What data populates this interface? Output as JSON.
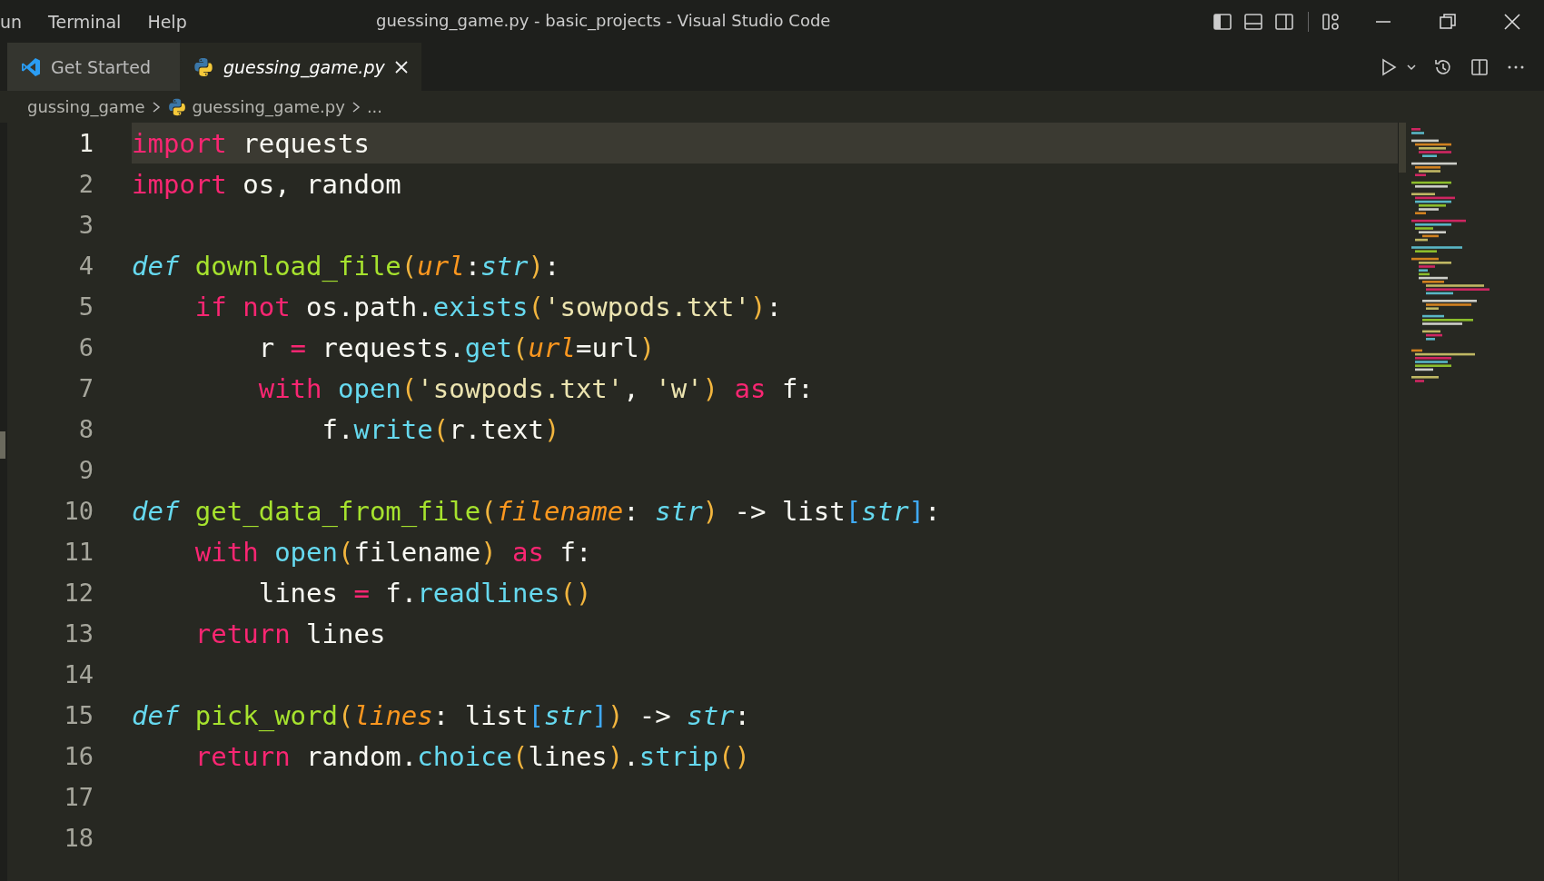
{
  "menu": [
    "un",
    "Terminal",
    "Help"
  ],
  "window": {
    "title": "guessing_game.py - basic_projects - Visual Studio Code"
  },
  "tabs": [
    {
      "label": "Get Started",
      "kind": "welcome",
      "selected": false,
      "preview": false,
      "close": false
    },
    {
      "label": "guessing_game.py",
      "kind": "python-file",
      "selected": true,
      "preview": true,
      "close": true
    }
  ],
  "breadcrumbs": [
    {
      "label": "gussing_game",
      "kind": "folder"
    },
    {
      "label": "guessing_game.py",
      "kind": "python-file"
    },
    {
      "label": "...",
      "kind": "symbol"
    }
  ],
  "editor": {
    "lines": [
      {
        "number": "1",
        "current": true,
        "tokens": [
          {
            "text": "import",
            "kind": "keyword"
          },
          {
            "text": " requests",
            "kind": "plain"
          }
        ]
      },
      {
        "number": "2",
        "current": false,
        "tokens": [
          {
            "text": "import",
            "kind": "keyword"
          },
          {
            "text": " os, random",
            "kind": "plain"
          }
        ]
      },
      {
        "number": "3",
        "current": false
      },
      {
        "number": "4",
        "current": false,
        "tokens": [
          {
            "text": "def",
            "kind": "storage"
          },
          {
            "text": " download_file",
            "kind": "function"
          },
          {
            "text": "(",
            "kind": "bracket"
          },
          {
            "text": "url",
            "kind": "param"
          },
          {
            "text": ":",
            "kind": "plain"
          },
          {
            "text": "str",
            "kind": "type"
          },
          {
            "text": ")",
            "kind": "bracket"
          },
          {
            "text": ":",
            "kind": "plain"
          }
        ]
      },
      {
        "number": "5",
        "current": false,
        "tokens": [
          {
            "text": "    if",
            "kind": "keyword"
          },
          {
            "text": " not",
            "kind": "keyword"
          },
          {
            "text": " os.path.",
            "kind": "plain"
          },
          {
            "text": "exists",
            "kind": "call"
          },
          {
            "text": "(",
            "kind": "bracket"
          },
          {
            "text": "'sowpods.txt'",
            "kind": "string"
          },
          {
            "text": ")",
            "kind": "bracket"
          },
          {
            "text": ":",
            "kind": "plain"
          }
        ]
      },
      {
        "number": "6",
        "current": false,
        "tokens": [
          {
            "text": "        r ",
            "kind": "plain"
          },
          {
            "text": "=",
            "kind": "operator"
          },
          {
            "text": " requests.",
            "kind": "plain"
          },
          {
            "text": "get",
            "kind": "call"
          },
          {
            "text": "(",
            "kind": "bracket"
          },
          {
            "text": "url",
            "kind": "param"
          },
          {
            "text": "=url",
            "kind": "plain"
          },
          {
            "text": ")",
            "kind": "bracket"
          }
        ]
      },
      {
        "number": "7",
        "current": false,
        "tokens": [
          {
            "text": "        with",
            "kind": "keyword"
          },
          {
            "text": " open",
            "kind": "call"
          },
          {
            "text": "(",
            "kind": "bracket"
          },
          {
            "text": "'sowpods.txt'",
            "kind": "string"
          },
          {
            "text": ",",
            "kind": "plain"
          },
          {
            "text": " 'w'",
            "kind": "string"
          },
          {
            "text": ")",
            "kind": "bracket"
          },
          {
            "text": " as",
            "kind": "keyword"
          },
          {
            "text": " f:",
            "kind": "plain"
          }
        ]
      },
      {
        "number": "8",
        "current": false,
        "tokens": [
          {
            "text": "            f.",
            "kind": "plain"
          },
          {
            "text": "write",
            "kind": "call"
          },
          {
            "text": "(",
            "kind": "bracket"
          },
          {
            "text": "r.text",
            "kind": "plain"
          },
          {
            "text": ")",
            "kind": "bracket"
          }
        ]
      },
      {
        "number": "9",
        "current": false
      },
      {
        "number": "10",
        "current": false,
        "tokens": [
          {
            "text": "def",
            "kind": "storage"
          },
          {
            "text": " get_data_from_file",
            "kind": "function"
          },
          {
            "text": "(",
            "kind": "bracket"
          },
          {
            "text": "filename",
            "kind": "param"
          },
          {
            "text": ":",
            "kind": "plain"
          },
          {
            "text": " str",
            "kind": "type"
          },
          {
            "text": ")",
            "kind": "bracket"
          },
          {
            "text": " -> list",
            "kind": "plain"
          },
          {
            "text": "[",
            "kind": "bracket2"
          },
          {
            "text": "str",
            "kind": "type"
          },
          {
            "text": "]",
            "kind": "bracket2"
          },
          {
            "text": ":",
            "kind": "plain"
          }
        ]
      },
      {
        "number": "11",
        "current": false,
        "tokens": [
          {
            "text": "    with",
            "kind": "keyword"
          },
          {
            "text": " open",
            "kind": "call"
          },
          {
            "text": "(",
            "kind": "bracket"
          },
          {
            "text": "filename",
            "kind": "plain"
          },
          {
            "text": ")",
            "kind": "bracket"
          },
          {
            "text": " as",
            "kind": "keyword"
          },
          {
            "text": " f:",
            "kind": "plain"
          }
        ]
      },
      {
        "number": "12",
        "current": false,
        "tokens": [
          {
            "text": "        lines ",
            "kind": "plain"
          },
          {
            "text": "=",
            "kind": "operator"
          },
          {
            "text": " f.",
            "kind": "plain"
          },
          {
            "text": "readlines",
            "kind": "call"
          },
          {
            "text": "()",
            "kind": "bracket"
          }
        ]
      },
      {
        "number": "13",
        "current": false,
        "tokens": [
          {
            "text": "    return",
            "kind": "keyword"
          },
          {
            "text": " lines",
            "kind": "plain"
          }
        ]
      },
      {
        "number": "14",
        "current": false
      },
      {
        "number": "15",
        "current": false,
        "tokens": [
          {
            "text": "def",
            "kind": "storage"
          },
          {
            "text": " pick_word",
            "kind": "function"
          },
          {
            "text": "(",
            "kind": "bracket"
          },
          {
            "text": "lines",
            "kind": "param"
          },
          {
            "text": ": list",
            "kind": "plain"
          },
          {
            "text": "[",
            "kind": "bracket2"
          },
          {
            "text": "str",
            "kind": "type"
          },
          {
            "text": "]",
            "kind": "bracket2"
          },
          {
            "text": ")",
            "kind": "bracket"
          },
          {
            "text": " ->",
            "kind": "plain"
          },
          {
            "text": " str",
            "kind": "type"
          },
          {
            "text": ":",
            "kind": "plain"
          }
        ]
      },
      {
        "number": "16",
        "current": false,
        "tokens": [
          {
            "text": "    return",
            "kind": "keyword"
          },
          {
            "text": " random.",
            "kind": "plain"
          },
          {
            "text": "choice",
            "kind": "call"
          },
          {
            "text": "(",
            "kind": "bracket"
          },
          {
            "text": "lines",
            "kind": "plain"
          },
          {
            "text": ")",
            "kind": "bracket"
          },
          {
            "text": ".",
            "kind": "plain"
          },
          {
            "text": "strip",
            "kind": "call"
          },
          {
            "text": "()",
            "kind": "bracket"
          }
        ]
      },
      {
        "number": "17",
        "current": false
      },
      {
        "number": "18",
        "current": false
      }
    ]
  }
}
